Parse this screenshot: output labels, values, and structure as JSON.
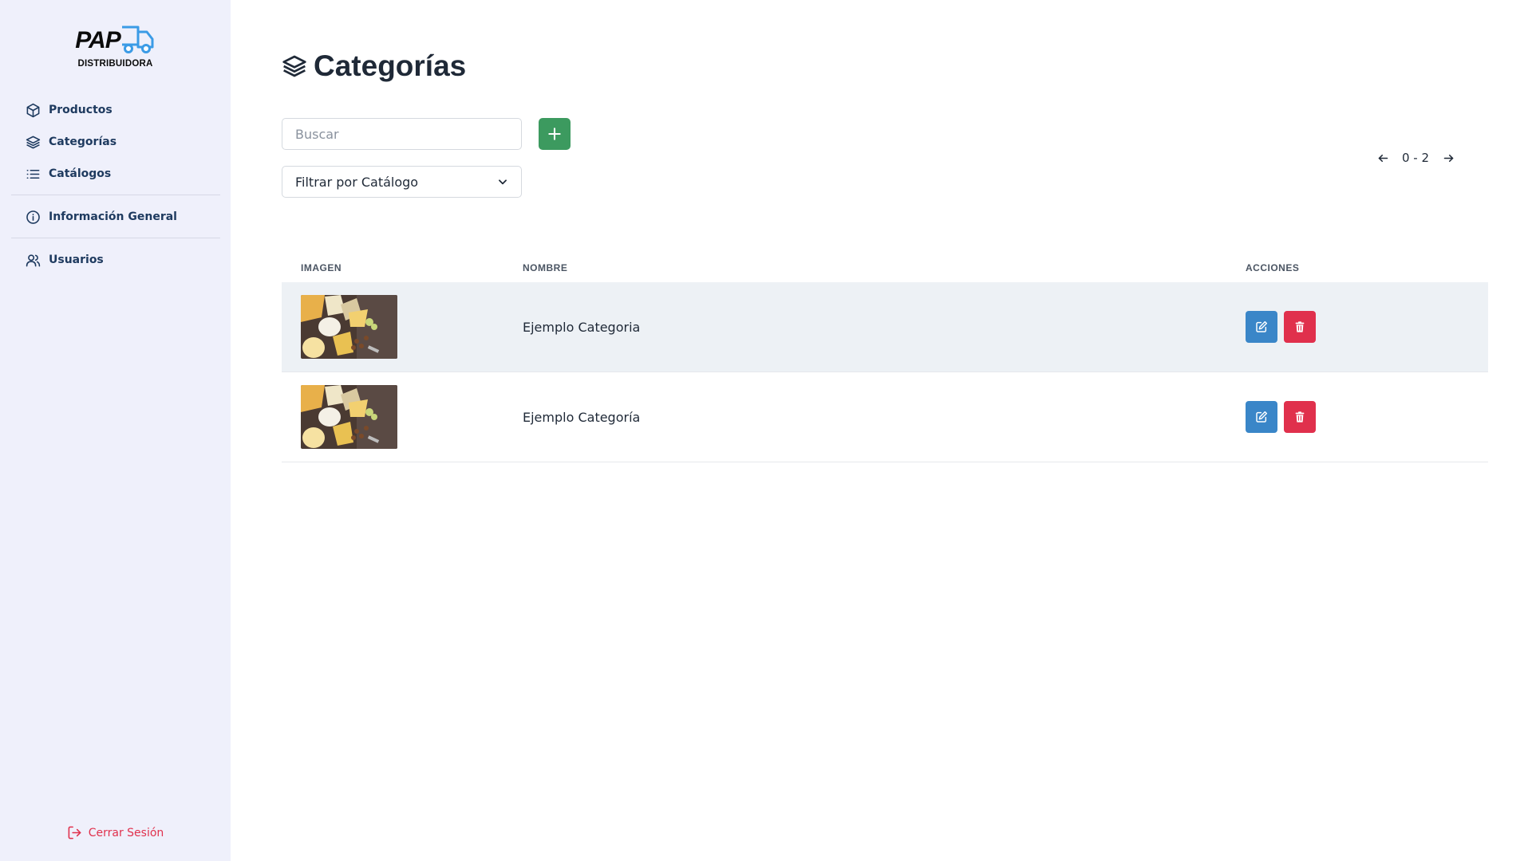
{
  "brand": {
    "logo_text": "PAP",
    "logo_subtitle": "DISTRIBUIDORA"
  },
  "sidebar": {
    "items": [
      {
        "label": "Productos",
        "icon": "box-icon"
      },
      {
        "label": "Categorías",
        "icon": "layers-icon"
      },
      {
        "label": "Catálogos",
        "icon": "list-icon"
      },
      {
        "label": "Información General",
        "icon": "info-icon"
      },
      {
        "label": "Usuarios",
        "icon": "users-icon"
      }
    ],
    "logout_label": "Cerrar Sesión"
  },
  "page": {
    "title": "Categorías"
  },
  "search": {
    "placeholder": "Buscar",
    "value": ""
  },
  "filter": {
    "selected": "Filtrar por Catálogo"
  },
  "pagination": {
    "range": "0 - 2"
  },
  "table": {
    "headers": [
      "IMAGEN",
      "NOMBRE",
      "ACCIONES"
    ],
    "rows": [
      {
        "name": "Ejemplo Categoria"
      },
      {
        "name": "Ejemplo Categoría"
      }
    ]
  },
  "colors": {
    "sidebar_bg": "#eff0fb",
    "nav_text": "#1e3a5f",
    "add_button": "#3c9a5f",
    "edit_button": "#3a86c8",
    "delete_button": "#e0304c",
    "logout_text": "#e0314d",
    "logo_accent": "#3b9be6"
  }
}
